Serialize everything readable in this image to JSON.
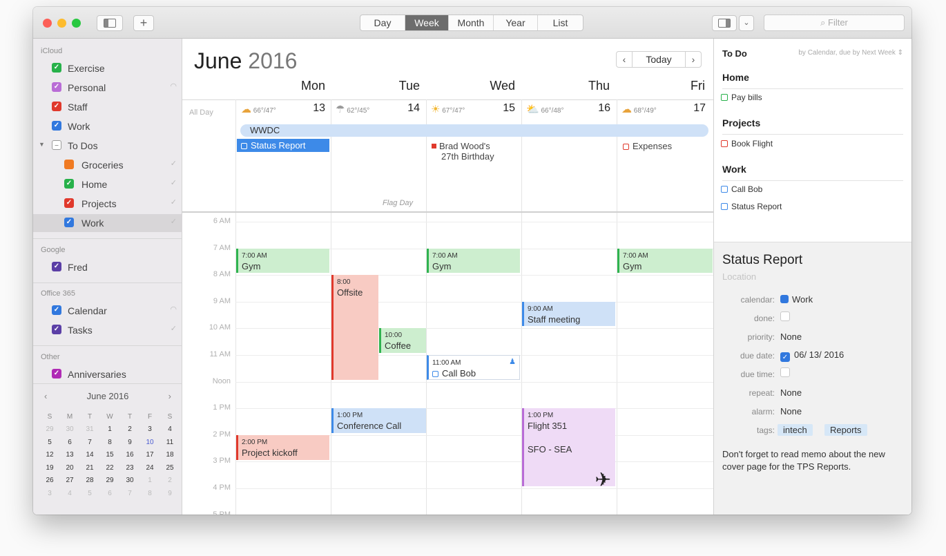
{
  "toolbar": {
    "views": [
      "Day",
      "Week",
      "Month",
      "Year",
      "List"
    ],
    "active_view": "Week",
    "filter_placeholder": "Filter",
    "add_label": "+"
  },
  "sidebar": {
    "groups": [
      {
        "name": "iCloud",
        "items": [
          {
            "label": "Exercise",
            "color": "#27b14a"
          },
          {
            "label": "Personal",
            "color": "#b96cd6"
          },
          {
            "label": "Staff",
            "color": "#e0392c"
          },
          {
            "label": "Work",
            "color": "#3178de"
          },
          {
            "label": "To Dos",
            "color": "#9a9a9a"
          },
          {
            "label": "Groceries",
            "color": "#f07a22"
          },
          {
            "label": "Home",
            "color": "#27b14a"
          },
          {
            "label": "Projects",
            "color": "#e0392c"
          },
          {
            "label": "Work",
            "color": "#3178de"
          }
        ]
      },
      {
        "name": "Google",
        "items": [
          {
            "label": "Fred",
            "color": "#5b3fa6"
          }
        ]
      },
      {
        "name": "Office 365",
        "items": [
          {
            "label": "Calendar",
            "color": "#3178de"
          },
          {
            "label": "Tasks",
            "color": "#5b3fa6"
          }
        ]
      },
      {
        "name": "Other",
        "items": [
          {
            "label": "Anniversaries",
            "color": "#b02bb5"
          }
        ]
      }
    ],
    "mini_calendar": {
      "month": "June 2016",
      "prev": "‹",
      "next": "›",
      "weekdays": [
        "S",
        "M",
        "T",
        "W",
        "T",
        "F",
        "S"
      ],
      "weeks": [
        [
          "29",
          "30",
          "31",
          "1",
          "2",
          "3",
          "4"
        ],
        [
          "5",
          "6",
          "7",
          "8",
          "9",
          "10",
          "11"
        ],
        [
          "12",
          "13",
          "14",
          "15",
          "16",
          "17",
          "18"
        ],
        [
          "19",
          "20",
          "21",
          "22",
          "23",
          "24",
          "25"
        ],
        [
          "26",
          "27",
          "28",
          "29",
          "30",
          "1",
          "2"
        ],
        [
          "3",
          "4",
          "5",
          "6",
          "7",
          "8",
          "9"
        ]
      ],
      "today": "10"
    }
  },
  "calendar": {
    "month": "June",
    "year": "2016",
    "today_label": "Today",
    "all_day_label": "All Day",
    "days": [
      {
        "name": "Mon",
        "num": "13",
        "weather": "66°/47°",
        "icon": "☁"
      },
      {
        "name": "Tue",
        "num": "14",
        "weather": "62°/45°",
        "icon": "☂"
      },
      {
        "name": "Wed",
        "num": "15",
        "weather": "67°/47°",
        "icon": "☀"
      },
      {
        "name": "Thu",
        "num": "16",
        "weather": "66°/48°",
        "icon": "⛅"
      },
      {
        "name": "Fri",
        "num": "17",
        "weather": "68°/49°",
        "icon": "☁"
      }
    ],
    "all_day": {
      "banner": "WWDC",
      "status_report": "Status Report",
      "birthday_line1": "Brad Wood's",
      "birthday_line2": "27th Birthday",
      "expenses": "Expenses",
      "flag_day": "Flag Day"
    },
    "hours": [
      "6 AM",
      "7 AM",
      "8 AM",
      "9 AM",
      "10 AM",
      "11 AM",
      "Noon",
      "1 PM",
      "2 PM",
      "3 PM",
      "4 PM",
      "5 PM"
    ],
    "events": [
      {
        "time": "7:00 AM",
        "title": "Gym"
      },
      {
        "time": "7:00 AM",
        "title": "Gym"
      },
      {
        "time": "7:00 AM",
        "title": "Gym"
      },
      {
        "time": "8:00",
        "title": "Offsite"
      },
      {
        "time": "10:00",
        "title": "Coffee"
      },
      {
        "time": "9:00 AM",
        "title": "Staff meeting"
      },
      {
        "time": "11:00 AM",
        "title": "Call Bob"
      },
      {
        "time": "1:00 PM",
        "title": "Conference Call"
      },
      {
        "time": "1:00 PM",
        "title": "Flight 351",
        "extra": "SFO - SEA"
      },
      {
        "time": "2:00 PM",
        "title": "Project kickoff"
      }
    ]
  },
  "todo": {
    "title": "To Do",
    "sort": "by Calendar, due by Next Week",
    "sections": [
      {
        "name": "Home",
        "items": [
          "Pay bills"
        ]
      },
      {
        "name": "Projects",
        "items": [
          "Book Flight"
        ]
      },
      {
        "name": "Work",
        "items": [
          "Call Bob",
          "Status Report"
        ]
      }
    ]
  },
  "detail": {
    "title": "Status Report",
    "location_placeholder": "Location",
    "fields": {
      "calendar": "Work",
      "priority": "None",
      "due_date": "06/ 13/ 2016",
      "repeat": "None",
      "alarm": "None"
    },
    "labels": {
      "calendar": "calendar:",
      "done": "done:",
      "priority": "priority:",
      "due_date": "due date:",
      "due_time": "due time:",
      "repeat": "repeat:",
      "alarm": "alarm:",
      "tags": "tags:"
    },
    "tags": [
      "intech",
      "Reports"
    ],
    "notes": "Don't forget to read memo about the new cover page for the TPS Reports."
  }
}
